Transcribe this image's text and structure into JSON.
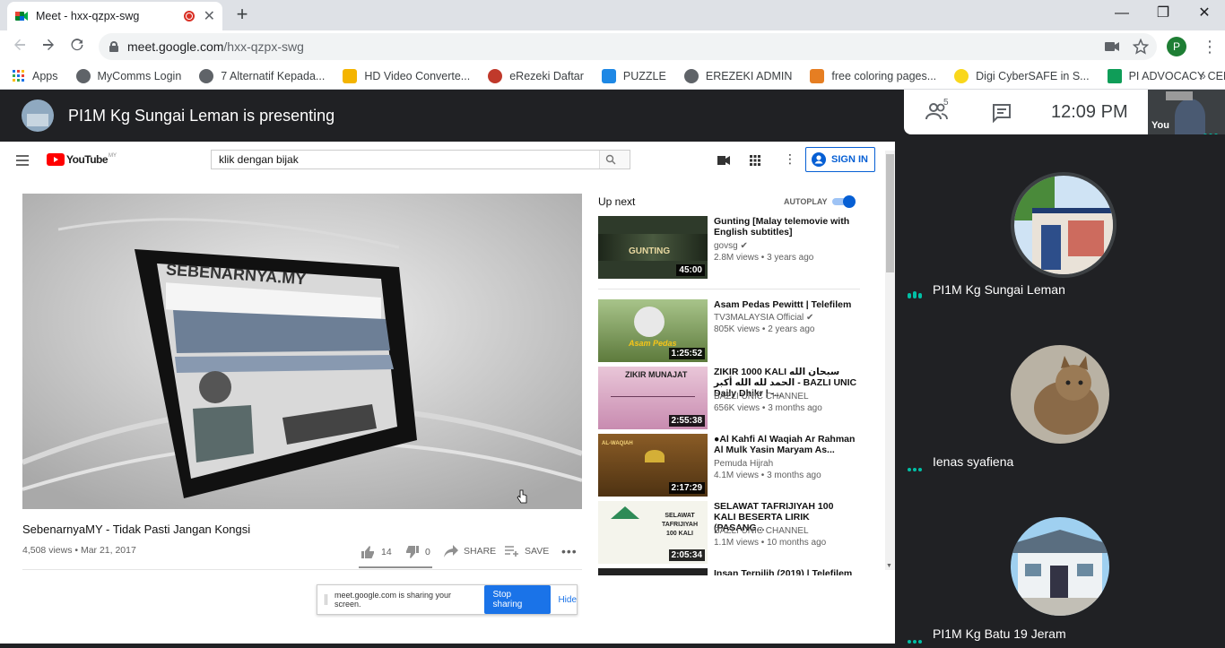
{
  "browser": {
    "tab_title": "Meet - hxx-qzpx-swg",
    "tab_close": "✕",
    "new_tab": "+",
    "url_host": "meet.google.com",
    "url_path": "/hxx-qzpx-swg",
    "profile_initial": "P",
    "window_controls": [
      "—",
      "❐",
      "✕"
    ],
    "bookmarks": [
      {
        "label": "Apps",
        "color": "#1a73e8"
      },
      {
        "label": "MyComms Login",
        "color": "#5f6368"
      },
      {
        "label": "7 Alternatif Kepada...",
        "color": "#5f6368"
      },
      {
        "label": "HD Video Converte...",
        "color": "#f4b400"
      },
      {
        "label": "eRezeki Daftar",
        "color": "#c0392b"
      },
      {
        "label": "PUZZLE",
        "color": "#1e88e5"
      },
      {
        "label": "EREZEKI ADMIN",
        "color": "#5f6368"
      },
      {
        "label": "free coloring pages...",
        "color": "#e67e22"
      },
      {
        "label": "Digi CyberSAFE in S...",
        "color": "#f9d71c"
      },
      {
        "label": "PI ADVOCACY CEN...",
        "color": "#0f9d58"
      }
    ],
    "bookmarks_more": "»"
  },
  "meet": {
    "presenting_title": "PI1M Kg Sungai Leman is presenting",
    "participant_count": "5",
    "time": "12:09  PM",
    "self_label": "You",
    "participants": [
      {
        "name": "PI1M Kg Sungai Leman"
      },
      {
        "name": "Ienas syafiena"
      },
      {
        "name": "PI1M Kg Batu 19 Jeram"
      }
    ]
  },
  "youtube": {
    "logo_text": "YouTube",
    "logo_sup": "MY",
    "search_value": "klik dengan bijak",
    "sign_in": "SIGN IN",
    "up_next": "Up next",
    "autoplay": "AUTOPLAY",
    "video_title": "SebenarnyaMY - Tidak Pasti Jangan Kongsi",
    "video_meta": "4,508 views • Mar 21, 2017",
    "likes": "14",
    "dislikes": "0",
    "share": "SHARE",
    "save": "SAVE",
    "screen_text": "SEBENARNYA.MY",
    "recommendations": [
      {
        "title": "Gunting [Malay telemovie with English subtitles]",
        "channel": "govsg ✔",
        "meta": "2.8M views • 3 years ago",
        "duration": "45:00",
        "thumb_color": "#2e3a2a",
        "thumb_text": "GUNTING"
      },
      {
        "title": "Asam Pedas Pewittt | Telefilem",
        "channel": "TV3MALAYSIA Official ✔",
        "meta": "805K views • 2 years ago",
        "duration": "1:25:52",
        "thumb_color": "#7aa35c",
        "thumb_text": "Asam Pedas"
      },
      {
        "title": "ZIKIR 1000 KALI سبحان الله الحمد لله الله أكبر - BAZLI UNIC Daily Dhikr | -...",
        "channel": "BAZLI UNIC CHANNEL",
        "meta": "656K views • 3 months ago",
        "duration": "2:55:38",
        "thumb_color": "#d7a6c2",
        "thumb_text": "ZIKIR MUNAJAT"
      },
      {
        "title": "●Al Kahfi Al Waqiah Ar Rahman Al Mulk Yasin Maryam As...",
        "channel": "Pemuda Hijrah",
        "meta": "4.1M views • 3 months ago",
        "duration": "2:17:29",
        "thumb_color": "#6b4a1e",
        "thumb_text": "AL-WAQIAH"
      },
      {
        "title": "SELAWAT TAFRIJIYAH 100 KALI BESERTA LIRIK (PASANG...",
        "channel": "BAZLI UNIC CHANNEL",
        "meta": "1.1M views • 10 months ago",
        "duration": "2:05:34",
        "thumb_color": "#f4f4ec",
        "thumb_text": "SELAWAT TAFRIJIYAH 100 KALI"
      },
      {
        "title": "Insan Terpilih (2019) | Telefilem",
        "channel": "",
        "meta": "",
        "duration": "",
        "thumb_color": "#222",
        "thumb_text": ""
      }
    ],
    "sharing_note": {
      "text": "meet.google.com is sharing your screen.",
      "stop": "Stop sharing",
      "hide": "Hide"
    }
  }
}
